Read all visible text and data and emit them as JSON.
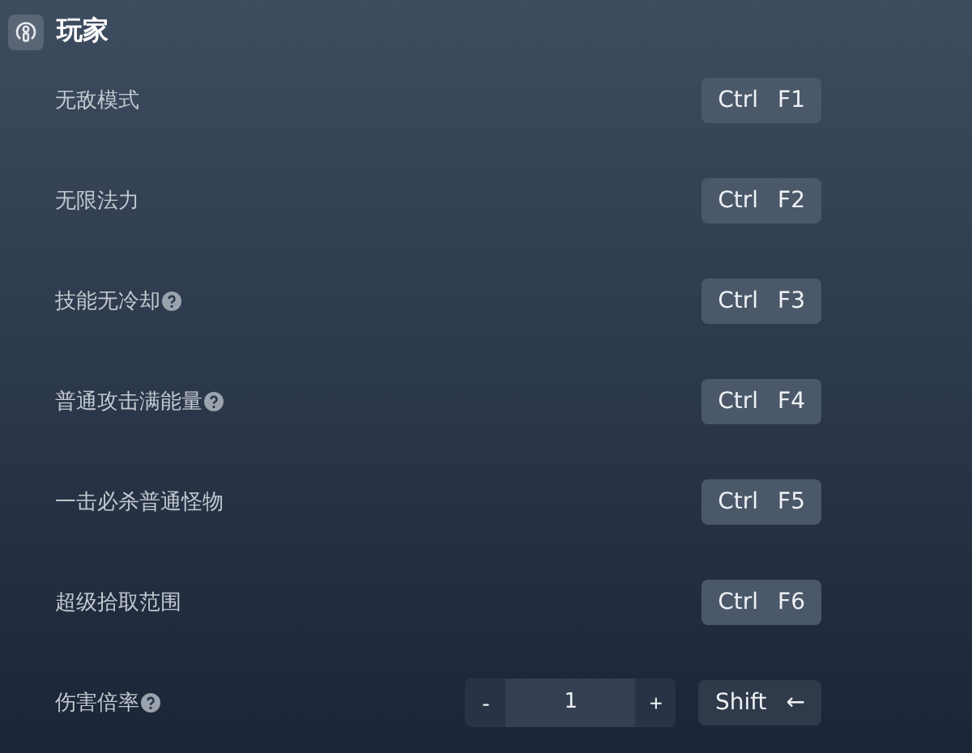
{
  "section": {
    "title": "玩家"
  },
  "rows": [
    {
      "kind": "toggle",
      "label": "无敌模式",
      "help": false,
      "hotkey": [
        "Ctrl",
        "F1"
      ]
    },
    {
      "kind": "toggle",
      "label": "无限法力",
      "help": false,
      "hotkey": [
        "Ctrl",
        "F2"
      ]
    },
    {
      "kind": "toggle",
      "label": "技能无冷却",
      "help": true,
      "hotkey": [
        "Ctrl",
        "F3"
      ]
    },
    {
      "kind": "toggle",
      "label": "普通攻击满能量",
      "help": true,
      "hotkey": [
        "Ctrl",
        "F4"
      ]
    },
    {
      "kind": "toggle",
      "label": "一击必杀普通怪物",
      "help": false,
      "hotkey": [
        "Ctrl",
        "F5"
      ]
    },
    {
      "kind": "toggle",
      "label": "超级拾取范围",
      "help": false,
      "hotkey": [
        "Ctrl",
        "F6"
      ]
    },
    {
      "kind": "stepper",
      "label": "伤害倍率",
      "help": true,
      "minus": "-",
      "value": "1",
      "plus": "+",
      "hotkey": [
        "Shift",
        "←"
      ]
    }
  ]
}
